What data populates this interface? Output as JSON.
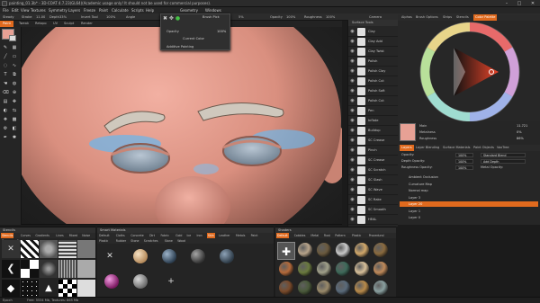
{
  "window": {
    "title": "painting_01.3b* - 3D-COAT 4.7.23(GL64)(Academic usage only! It should not be used for commercial purposes).",
    "controls": [
      "–",
      "□",
      "✕"
    ]
  },
  "menubar": [
    "File",
    "Edit",
    "View",
    "Textures",
    "Symmetry",
    "Layers",
    "Freeze",
    "Paint",
    "Calculate",
    "Scripts",
    "Help",
    "Geometry",
    "Windows"
  ],
  "toolbar": {
    "brush_label": "Steady",
    "stroke_label": "Stroke",
    "radius_label": "Radius",
    "radius_value": "11.00",
    "depth_label": "Depth",
    "depth_value": "33%",
    "opacity_label": "Opacity",
    "opacity_value": "100%",
    "angle_label": "Angle",
    "invert_label": "Invert Tool",
    "stroke_value": "54%",
    "depth2_value": "5%",
    "always_label": "Always",
    "roughness_label": "Roughness",
    "roughness_value": "100%",
    "camera_label": "Camera"
  },
  "room_tabs": [
    {
      "label": "Paint",
      "active": true
    },
    {
      "label": "Tweak",
      "active": false
    },
    {
      "label": "Retopo",
      "active": false
    },
    {
      "label": "UV",
      "active": false
    },
    {
      "label": "Sculpt",
      "active": false
    },
    {
      "label": "Render",
      "active": false
    }
  ],
  "brush_popup": {
    "title": "Brush Pick",
    "opacity_label": "Opacity",
    "opacity_value": "100%",
    "color_mode": "Current Color",
    "option_label": "Additive Painting"
  },
  "stroke_panel": {
    "header": "Surface Tools",
    "items": [
      "Clay",
      "Clay Add",
      "Clay Twist",
      "Polish",
      "Polish Clay",
      "Polish Cut",
      "Polish Soft",
      "Polish Cut",
      "Pen",
      "Inflate",
      "Buildup",
      "SC Crease",
      "Pinch",
      "SC Crease",
      "SC Scratch",
      "SC Slash",
      "SC Wave",
      "SC Rake",
      "SC Smooth",
      "HEAL"
    ]
  },
  "right_tabs": [
    {
      "label": "Alphas",
      "active": false
    },
    {
      "label": "Brush Options",
      "active": false
    },
    {
      "label": "Strips",
      "active": false
    },
    {
      "label": "Stencils",
      "active": false
    },
    {
      "label": "Color Palette",
      "active": true
    }
  ],
  "color": {
    "primary": "#e7a195",
    "hue": "#e8452a"
  },
  "material": {
    "rows": [
      {
        "key": "Main",
        "value": "11.721"
      },
      {
        "key": "Metalness",
        "value": "0%"
      },
      {
        "key": "Roughness",
        "value": "86%"
      }
    ]
  },
  "layer_tabs": [
    {
      "label": "Layers",
      "active": true
    },
    {
      "label": "Layer Blending",
      "active": false
    },
    {
      "label": "Surface Materials",
      "active": false
    },
    {
      "label": "Paint Objects",
      "active": false
    },
    {
      "label": "VoxTree",
      "active": false
    }
  ],
  "layers": {
    "props": [
      {
        "label": "Opacity:",
        "value": "100%",
        "extra": "Standard Blend"
      },
      {
        "label": "Depth Opacity:",
        "value": "100%",
        "extra": "Add Depth"
      },
      {
        "label": "Roughness Opacity:",
        "value": "100%",
        "extra": "Metal Opacity:"
      }
    ],
    "items": [
      {
        "label": "Ambient Occlusion",
        "selected": false
      },
      {
        "label": "Curvature Map",
        "selected": false
      },
      {
        "label": "Normal map",
        "selected": false
      },
      {
        "label": "Layer 3",
        "selected": false
      },
      {
        "label": "Layer 20",
        "selected": true
      },
      {
        "label": "Layer 1",
        "selected": false
      },
      {
        "label": "Layer 0",
        "selected": false
      }
    ]
  },
  "bottom": {
    "stencils": {
      "caption": "Stencils",
      "tabs": [
        {
          "label": "Stencils",
          "active": true
        },
        {
          "label": "Curves",
          "active": false
        },
        {
          "label": "Gradients",
          "active": false
        },
        {
          "label": "Lines",
          "active": false
        },
        {
          "label": "Mixed",
          "active": false
        },
        {
          "label": "Noise",
          "active": false
        },
        {
          "label": "Square",
          "active": false
        },
        {
          "label": "Squares",
          "active": false
        }
      ]
    },
    "materials": {
      "caption": "Smart Materials",
      "tabs": [
        {
          "label": "Default",
          "active": false
        },
        {
          "label": "Cloths",
          "active": false
        },
        {
          "label": "Concrete",
          "active": false
        },
        {
          "label": "Dirt",
          "active": false
        },
        {
          "label": "Fabric",
          "active": false
        },
        {
          "label": "Gold",
          "active": false
        },
        {
          "label": "Ice",
          "active": false
        },
        {
          "label": "Iron",
          "active": false
        },
        {
          "label": "Skin",
          "active": true
        },
        {
          "label": "Leather",
          "active": false
        },
        {
          "label": "Metals",
          "active": false
        },
        {
          "label": "Paint",
          "active": false
        },
        {
          "label": "Plastic",
          "active": false
        },
        {
          "label": "Rubber",
          "active": false
        },
        {
          "label": "Stone",
          "active": false
        },
        {
          "label": "Scratches",
          "active": false
        },
        {
          "label": "Stone",
          "active": false
        },
        {
          "label": "Wood",
          "active": false
        }
      ]
    },
    "shaders": {
      "caption": "Shaders",
      "tabs": [
        {
          "label": "Default",
          "active": true
        },
        {
          "label": "Cobbles",
          "active": false
        },
        {
          "label": "Metal",
          "active": false
        },
        {
          "label": "Rust",
          "active": false
        },
        {
          "label": "Pattern",
          "active": false
        },
        {
          "label": "Plastic",
          "active": false
        },
        {
          "label": "Procedural",
          "active": false
        }
      ]
    }
  },
  "status": {
    "left": "Epoch",
    "mid": "Free: 5534 Mb, Textures: 865 Mb"
  }
}
